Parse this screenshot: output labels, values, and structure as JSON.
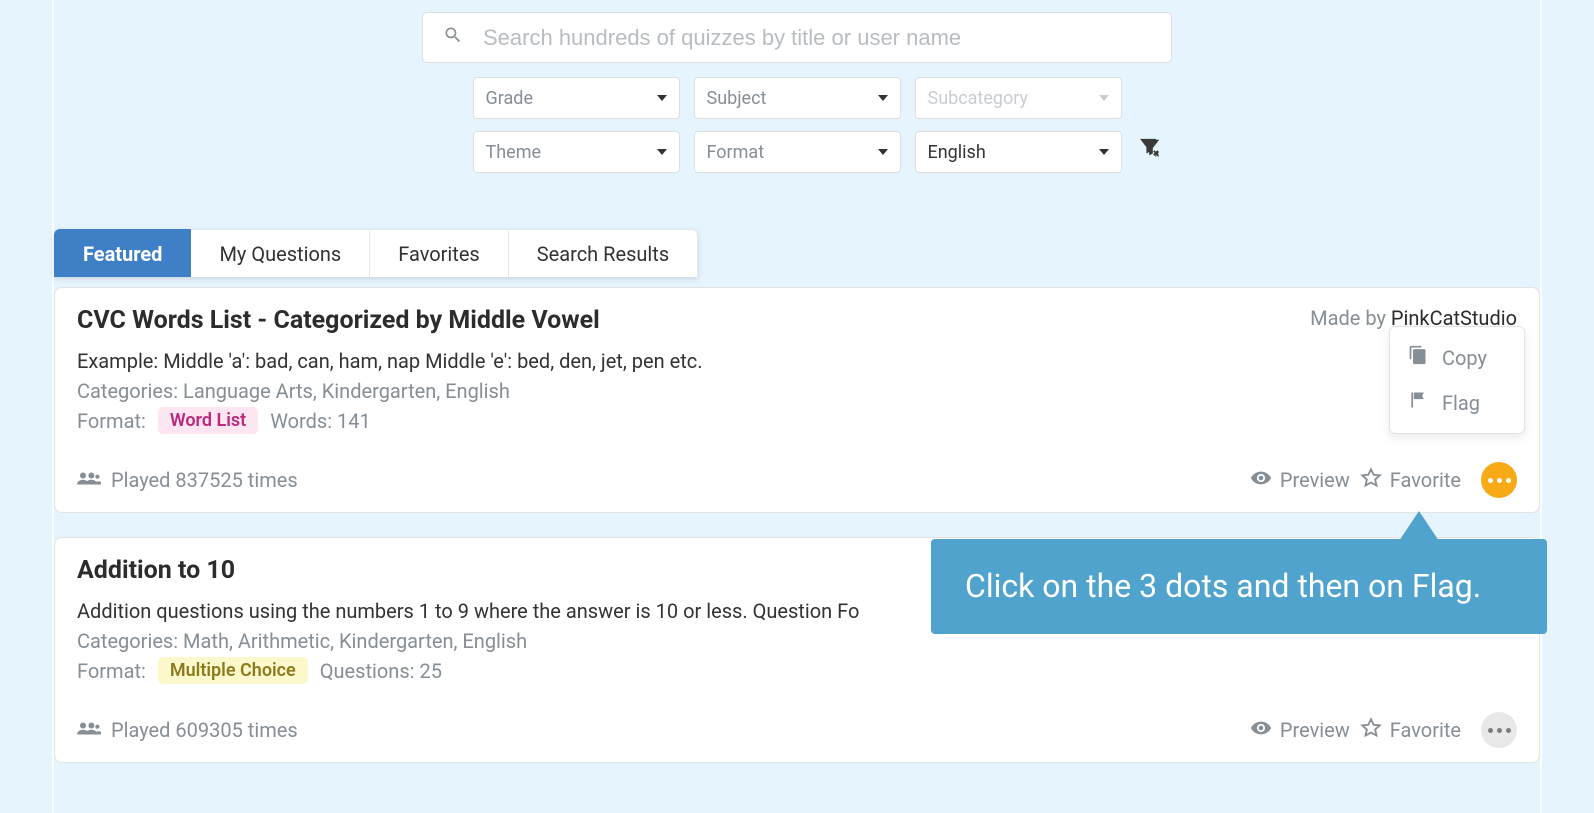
{
  "search": {
    "placeholder": "Search hundreds of quizzes by title or user name"
  },
  "filters": {
    "row1": [
      {
        "label": "Grade",
        "state": "placeholder"
      },
      {
        "label": "Subject",
        "state": "placeholder"
      },
      {
        "label": "Subcategory",
        "state": "disabled"
      }
    ],
    "row2": [
      {
        "label": "Theme",
        "state": "placeholder"
      },
      {
        "label": "Format",
        "state": "placeholder"
      },
      {
        "label": "English",
        "state": "value"
      }
    ]
  },
  "tabs": [
    {
      "label": "Featured",
      "active": true
    },
    {
      "label": "My Questions",
      "active": false
    },
    {
      "label": "Favorites",
      "active": false
    },
    {
      "label": "Search Results",
      "active": false
    }
  ],
  "popover": {
    "items": [
      {
        "icon": "copy",
        "label": "Copy"
      },
      {
        "icon": "flag",
        "label": "Flag"
      }
    ]
  },
  "cards": [
    {
      "title": "CVC Words List - Categorized by Middle Vowel",
      "made_by_prefix": "Made by ",
      "author": "PinkCatStudio",
      "example": "Example: Middle 'a': bad, can, ham, nap Middle 'e': bed, den, jet, pen etc.",
      "categories": "Categories: Language Arts, Kindergarten, English",
      "format_label": "Format:",
      "format_badge": "Word List",
      "format_badge_style": "pink",
      "count_label": "Words: 141",
      "played": "Played 837525 times",
      "preview": "Preview",
      "favorite": "Favorite",
      "more_open": true
    },
    {
      "title": "Addition to 10",
      "made_by_prefix": "",
      "author": "",
      "example": "Addition questions using the numbers 1 to 9 where the answer is 10 or less. Question Fo",
      "categories": "Categories: Math, Arithmetic, Kindergarten, English",
      "format_label": "Format:",
      "format_badge": "Multiple Choice",
      "format_badge_style": "yellow",
      "count_label": "Questions: 25",
      "played": "Played 609305 times",
      "preview": "Preview",
      "favorite": "Favorite",
      "more_open": false
    }
  ],
  "tooltip": {
    "text": "Click on the 3 dots and then on Flag."
  }
}
